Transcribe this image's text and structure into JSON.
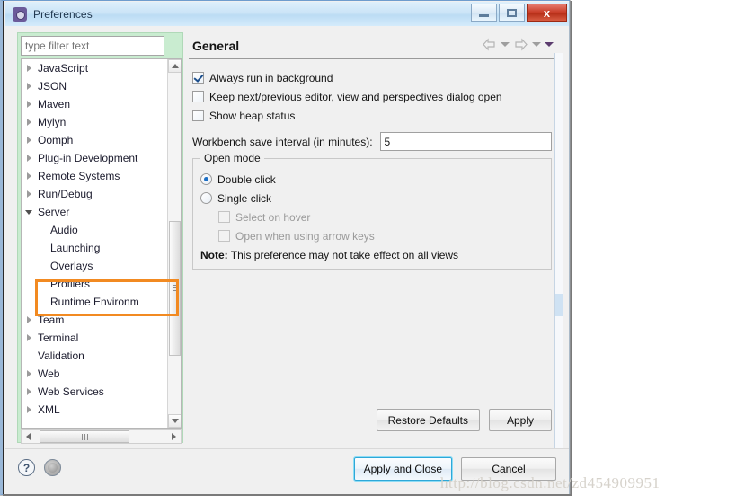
{
  "window": {
    "title": "Preferences",
    "icon": "preferences-gear-icon",
    "buttons": {
      "minimize": "minimize-icon",
      "maximize": "maximize-icon",
      "close": "x"
    }
  },
  "filter": {
    "placeholder": "type filter text",
    "value": ""
  },
  "tree": {
    "items": [
      {
        "label": "JavaScript",
        "expandable": true,
        "expanded": false,
        "indent": 0
      },
      {
        "label": "JSON",
        "expandable": true,
        "expanded": false,
        "indent": 0
      },
      {
        "label": "Maven",
        "expandable": true,
        "expanded": false,
        "indent": 0
      },
      {
        "label": "Mylyn",
        "expandable": true,
        "expanded": false,
        "indent": 0
      },
      {
        "label": "Oomph",
        "expandable": true,
        "expanded": false,
        "indent": 0
      },
      {
        "label": "Plug-in Development",
        "expandable": true,
        "expanded": false,
        "indent": 0
      },
      {
        "label": "Remote Systems",
        "expandable": true,
        "expanded": false,
        "indent": 0
      },
      {
        "label": "Run/Debug",
        "expandable": true,
        "expanded": false,
        "indent": 0
      },
      {
        "label": "Server",
        "expandable": true,
        "expanded": true,
        "indent": 0
      },
      {
        "label": "Audio",
        "expandable": false,
        "expanded": false,
        "indent": 1
      },
      {
        "label": "Launching",
        "expandable": false,
        "expanded": false,
        "indent": 1
      },
      {
        "label": "Overlays",
        "expandable": false,
        "expanded": false,
        "indent": 1
      },
      {
        "label": "Profilers",
        "expandable": false,
        "expanded": false,
        "indent": 1
      },
      {
        "label": "Runtime Environm",
        "expandable": false,
        "expanded": false,
        "indent": 1
      },
      {
        "label": "Team",
        "expandable": true,
        "expanded": false,
        "indent": 0
      },
      {
        "label": "Terminal",
        "expandable": true,
        "expanded": false,
        "indent": 0
      },
      {
        "label": "Validation",
        "expandable": false,
        "expanded": false,
        "indent": 0
      },
      {
        "label": "Web",
        "expandable": true,
        "expanded": false,
        "indent": 0
      },
      {
        "label": "Web Services",
        "expandable": true,
        "expanded": false,
        "indent": 0
      },
      {
        "label": "XML",
        "expandable": true,
        "expanded": false,
        "indent": 0
      }
    ]
  },
  "highlight": {
    "color": "#f28a21",
    "covers": [
      "Profilers",
      "Runtime Environm"
    ]
  },
  "page": {
    "title": "General",
    "nav": {
      "back": "back-arrow-icon",
      "back_menu": "chevron-down-icon",
      "forward": "forward-arrow-icon",
      "forward_menu": "chevron-down-icon",
      "view_menu": "view-menu-icon"
    },
    "checkboxes": [
      {
        "label": "Always run in background",
        "checked": true,
        "enabled": true
      },
      {
        "label": "Keep next/previous editor, view and perspectives dialog open",
        "checked": false,
        "enabled": true
      },
      {
        "label": "Show heap status",
        "checked": false,
        "enabled": true
      }
    ],
    "save_interval": {
      "label": "Workbench save interval (in minutes):",
      "value": "5"
    },
    "open_mode": {
      "title": "Open mode",
      "radios": [
        {
          "label": "Double click",
          "selected": true
        },
        {
          "label": "Single click",
          "selected": false
        }
      ],
      "sub_checkboxes": [
        {
          "label": "Select on hover",
          "checked": false,
          "enabled": false
        },
        {
          "label": "Open when using arrow keys",
          "checked": false,
          "enabled": false
        }
      ],
      "note_prefix": "Note:",
      "note_text": "This preference may not take effect on all views"
    },
    "buttons": {
      "restore_defaults": "Restore Defaults",
      "apply": "Apply"
    }
  },
  "footer": {
    "help_icon": "?",
    "secondary_icon": "circle-icon",
    "apply_and_close": "Apply and Close",
    "cancel": "Cancel"
  },
  "watermark": {
    "text": "http://blog.csdn.net/zd454909951"
  }
}
